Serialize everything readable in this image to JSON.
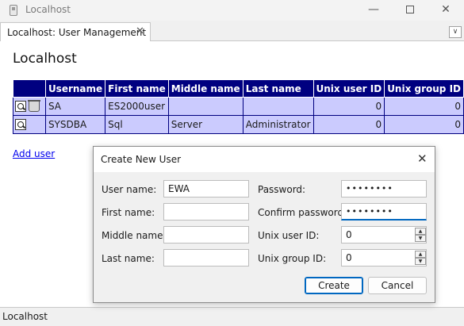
{
  "window": {
    "title": "Localhost"
  },
  "tab": {
    "label": "Localhost: User Management",
    "close_glyph": "✕",
    "menu_glyph": "∨"
  },
  "page": {
    "title": "Localhost"
  },
  "table": {
    "columns": [
      "",
      "Username",
      "First name",
      "Middle name",
      "Last name",
      "Unix user ID",
      "Unix group ID"
    ],
    "rows": [
      {
        "username": "SA",
        "first": "ES2000user",
        "middle": "",
        "last": "",
        "uid": "0",
        "gid": "0"
      },
      {
        "username": "SYSDBA",
        "first": "Sql",
        "middle": "Server",
        "last": "Administrator",
        "uid": "0",
        "gid": "0"
      }
    ]
  },
  "add_user_link": "Add user",
  "status": {
    "text": "Localhost"
  },
  "dialog": {
    "title": "Create New User",
    "labels": {
      "user_name": "User name:",
      "first_name": "First name:",
      "middle_name": "Middle name:",
      "last_name": "Last name:",
      "password": "Password:",
      "confirm_password": "Confirm password:",
      "unix_user_id": "Unix user ID:",
      "unix_group_id": "Unix group ID:"
    },
    "values": {
      "user_name": "EWA",
      "first_name": "",
      "middle_name": "",
      "last_name": "",
      "password": "••••••••",
      "confirm_password": "••••••••",
      "unix_user_id": "0",
      "unix_group_id": "0"
    },
    "buttons": {
      "create": "Create",
      "cancel": "Cancel"
    }
  },
  "colors": {
    "table_header": "#000080",
    "table_row": "#cbcbfe",
    "link": "#0000ee",
    "focus_accent": "#0067c0"
  },
  "icons": [
    "app-window-icon",
    "view-details-icon",
    "delete-trash-icon",
    "close-icon",
    "spinner-up-icon",
    "spinner-down-icon"
  ]
}
